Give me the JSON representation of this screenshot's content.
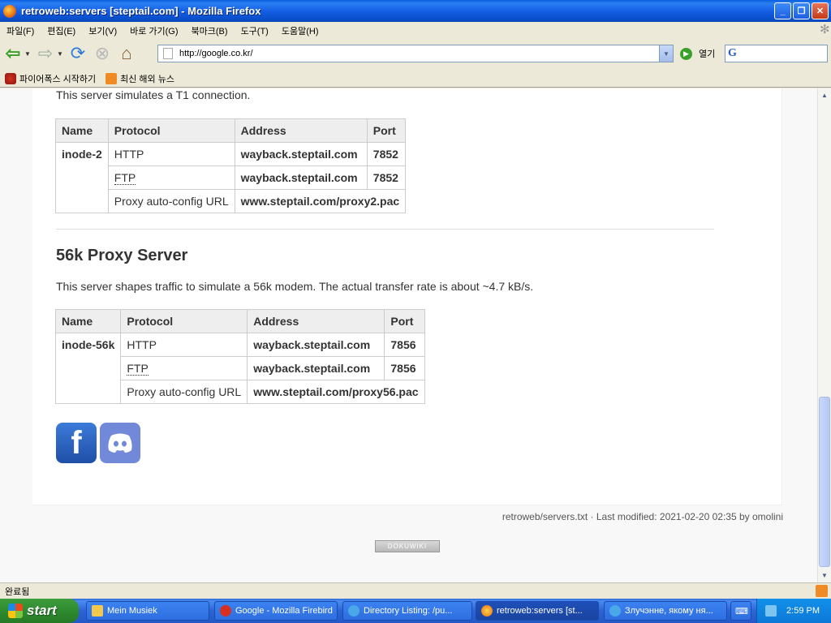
{
  "window": {
    "title": "retroweb:servers [steptail.com] - Mozilla Firefox"
  },
  "menu": [
    "파일(F)",
    "편집(E)",
    "보기(V)",
    "바로 가기(G)",
    "북마크(B)",
    "도구(T)",
    "도움말(H)"
  ],
  "nav": {
    "url": "http://google.co.kr/",
    "go_label": "열기"
  },
  "bookmarks": [
    {
      "label": "파이어폭스 시작하기",
      "icon": "firefox-icon"
    },
    {
      "label": "최신 해외 뉴스",
      "icon": "rss-icon"
    }
  ],
  "page": {
    "t1_text": "This server simulates a T1 connection.",
    "headers": [
      "Name",
      "Protocol",
      "Address",
      "Port"
    ],
    "t1_table": {
      "name": "inode-2",
      "rows": [
        {
          "protocol": "HTTP",
          "address": "wayback.steptail.com",
          "port": "7852"
        },
        {
          "protocol": "FTP",
          "address": "wayback.steptail.com",
          "port": "7852"
        },
        {
          "protocol": "Proxy auto-config URL",
          "address": "www.steptail.com/proxy2.pac",
          "port": ""
        }
      ]
    },
    "section_title": "56k Proxy Server",
    "section_text": "This server shapes traffic to simulate a 56k modem. The actual transfer rate is about ~4.7 kB/s.",
    "k56_table": {
      "name": "inode-56k",
      "rows": [
        {
          "protocol": "HTTP",
          "address": "wayback.steptail.com",
          "port": "7856"
        },
        {
          "protocol": "FTP",
          "address": "wayback.steptail.com",
          "port": "7856"
        },
        {
          "protocol": "Proxy auto-config URL",
          "address": "www.steptail.com/proxy56.pac",
          "port": ""
        }
      ]
    },
    "footer_meta": "retroweb/servers.txt · Last modified: 2021-02-20 02:35 by omolini",
    "badge": "DOKUWIKI"
  },
  "status": {
    "text": "완료됨"
  },
  "taskbar": {
    "start": "start",
    "tasks": [
      {
        "label": "Mein Musiek",
        "icon": "folder-icon"
      },
      {
        "label": "Google - Mozilla Firebird",
        "icon": "firebird-icon"
      },
      {
        "label": "Directory Listing: /pu...",
        "icon": "ie-icon"
      },
      {
        "label": "retroweb:servers [st...",
        "icon": "firefox-icon"
      },
      {
        "label": "Злучэнне, якому ня...",
        "icon": "ie-icon"
      }
    ],
    "clock": "2:59 PM"
  }
}
